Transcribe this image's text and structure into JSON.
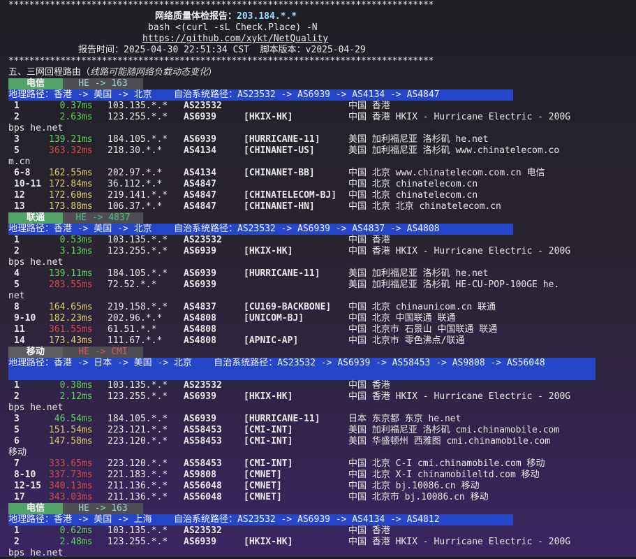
{
  "stars": "**********************************************************************************",
  "header": {
    "title": "网络质量体检报告：",
    "ip": "203.184.*.*",
    "command": "bash <(curl -sL Check.Place) -N",
    "url": "https://github.com/xykt/NetQuality",
    "report_time": "报告时间：2025-04-30 22:51:34 CST  脚本版本：v2025-04-29"
  },
  "section": {
    "title": "五、三网回程路由（",
    "note": "线路可能随网络负载动态变化",
    "close": "）"
  },
  "colors": {
    "path_bar": "#2546c8",
    "isp_tag": "#53a26a",
    "latency_good": "#5fd35f",
    "latency_bad": "#d84848"
  },
  "routes": [
    {
      "isp": "电信",
      "tag_path": "HE -> 163",
      "geo_path": "地理路径：香港 -> 美国 -> 北京",
      "as_path": "自治系统路径：AS23532 -> AS6939 -> AS4134 -> AS4847",
      "hops": [
        {
          "hop": "1",
          "latency": "0.37ms",
          "lat_class": "g",
          "ip": "103.135.*.*",
          "asn": "AS23532",
          "name": "",
          "geo": "中国 香港",
          "wrap": ""
        },
        {
          "hop": "2",
          "latency": "2.63ms",
          "lat_class": "g",
          "ip": "123.255.*.*",
          "asn": "AS6939",
          "name": "[HKIX-HK]",
          "geo": "中国 香港 HKIX - Hurricane Electric - 200G",
          "wrap": "bps he.net"
        },
        {
          "hop": "3",
          "latency": "139.21ms",
          "lat_class": "g",
          "ip": "184.105.*.*",
          "asn": "AS6939",
          "name": "[HURRICANE-11]",
          "geo": "美国 加利福尼亚 洛杉矶 he.net",
          "wrap": ""
        },
        {
          "hop": "5",
          "latency": "363.32ms",
          "lat_class": "r",
          "ip": "218.30.*.*",
          "asn": "AS4134",
          "name": "[CHINANET-US]",
          "geo": "美国 加利福尼亚 洛杉矶 www.chinatelecom.co",
          "wrap": "m.cn"
        },
        {
          "hop": "6-8",
          "latency": "162.55ms",
          "lat_class": "o",
          "ip": "202.97.*.*",
          "asn": "AS4134",
          "name": "[CHINANET-BB]",
          "geo": "中国 北京 www.chinatelecom.com.cn 电信",
          "wrap": ""
        },
        {
          "hop": "10-11",
          "latency": "172.84ms",
          "lat_class": "o",
          "ip": "36.112.*.*",
          "asn": "AS4847",
          "name": "",
          "geo": "中国 北京 chinatelecom.cn",
          "wrap": ""
        },
        {
          "hop": "12",
          "latency": "172.60ms",
          "lat_class": "o",
          "ip": "219.141.*.*",
          "asn": "AS4847",
          "name": "[CHINATELECOM-BJ]",
          "geo": "中国 北京 chinatelecom.cn",
          "wrap": ""
        },
        {
          "hop": "13",
          "latency": "173.88ms",
          "lat_class": "o",
          "ip": "106.37.*.*",
          "asn": "AS4847",
          "name": "[CHINANET-HN]",
          "geo": "中国 北京 北京 chinatelecom.cn",
          "wrap": ""
        }
      ]
    },
    {
      "isp": "联通",
      "tag_path": "HE -> 4837",
      "geo_path": "地理路径：香港 -> 美国 -> 北京",
      "as_path": "自治系统路径：AS23532 -> AS6939 -> AS4837 -> AS4808",
      "hops": [
        {
          "hop": "1",
          "latency": "0.53ms",
          "lat_class": "g",
          "ip": "103.135.*.*",
          "asn": "AS23532",
          "name": "",
          "geo": "中国 香港",
          "wrap": ""
        },
        {
          "hop": "2",
          "latency": "3.13ms",
          "lat_class": "g",
          "ip": "123.255.*.*",
          "asn": "AS6939",
          "name": "[HKIX-HK]",
          "geo": "中国 香港 HKIX - Hurricane Electric - 200G",
          "wrap": "bps he.net"
        },
        {
          "hop": "4",
          "latency": "139.11ms",
          "lat_class": "g",
          "ip": "184.105.*.*",
          "asn": "AS6939",
          "name": "[HURRICANE-11]",
          "geo": "美国 加利福尼亚 洛杉矶 he.net",
          "wrap": ""
        },
        {
          "hop": "5",
          "latency": "283.55ms",
          "lat_class": "r",
          "ip": "72.52.*.*",
          "asn": "AS6939",
          "name": "",
          "geo": "美国 加利福尼亚 洛杉矶 HE-CU-POP-100GE he.",
          "wrap": "net"
        },
        {
          "hop": "8",
          "latency": "164.65ms",
          "lat_class": "o",
          "ip": "219.158.*.*",
          "asn": "AS4837",
          "name": "[CU169-BACKBONE]",
          "geo": "中国 北京 chinaunicom.cn 联通",
          "wrap": ""
        },
        {
          "hop": "9-10",
          "latency": "182.23ms",
          "lat_class": "o",
          "ip": "202.96.*.*",
          "asn": "AS4808",
          "name": "[UNICOM-BJ]",
          "geo": "中国 北京 中国联通 联通",
          "wrap": ""
        },
        {
          "hop": "11",
          "latency": "361.55ms",
          "lat_class": "r",
          "ip": "61.51.*.*",
          "asn": "AS4808",
          "name": "",
          "geo": "中国 北京市 石景山 中国联通 联通",
          "wrap": ""
        },
        {
          "hop": "14",
          "latency": "173.43ms",
          "lat_class": "o",
          "ip": "111.67.*.*",
          "asn": "AS4808",
          "name": "[APNIC-AP]",
          "geo": "中国 北京市 零色沸点/联通",
          "wrap": ""
        }
      ]
    },
    {
      "isp": "移动",
      "tag_path": "HE -> CMI",
      "geo_path": "地理路径：香港 -> 日本 -> 美国 -> 北京",
      "as_path": "自治系统路径：AS23532 -> AS6939 -> AS58453 -> AS9808 -> AS56048",
      "hops": [
        {
          "hop": "1",
          "latency": "0.38ms",
          "lat_class": "g",
          "ip": "103.135.*.*",
          "asn": "AS23532",
          "name": "",
          "geo": "中国 香港",
          "wrap": ""
        },
        {
          "hop": "2",
          "latency": "2.12ms",
          "lat_class": "g",
          "ip": "123.255.*.*",
          "asn": "AS6939",
          "name": "[HKIX-HK]",
          "geo": "中国 香港 HKIX - Hurricane Electric - 200G",
          "wrap": "bps he.net"
        },
        {
          "hop": "3",
          "latency": "46.54ms",
          "lat_class": "g",
          "ip": "184.105.*.*",
          "asn": "AS6939",
          "name": "[HURRICANE-11]",
          "geo": "日本 东京都 东京 he.net",
          "wrap": ""
        },
        {
          "hop": "5",
          "latency": "151.54ms",
          "lat_class": "o",
          "ip": "223.121.*.*",
          "asn": "AS58453",
          "name": "[CMI-INT]",
          "geo": "美国 加利福尼亚 洛杉矶 cmi.chinamobile.com",
          "wrap": ""
        },
        {
          "hop": "6",
          "latency": "147.58ms",
          "lat_class": "o",
          "ip": "223.120.*.*",
          "asn": "AS58453",
          "name": "[CMI-INT]",
          "geo": "美国 华盛顿州 西雅图 cmi.chinamobile.com",
          "wrap": "移动"
        },
        {
          "hop": "7",
          "latency": "333.65ms",
          "lat_class": "r",
          "ip": "223.120.*.*",
          "asn": "AS58453",
          "name": "[CMI-INT]",
          "geo": "中国 北京 C-I cmi.chinamobile.com 移动",
          "wrap": ""
        },
        {
          "hop": "8-10",
          "latency": "337.73ms",
          "lat_class": "r",
          "ip": "221.183.*.*",
          "asn": "AS9808",
          "name": "[CMNET]",
          "geo": "中国 北京 X-I chinamobileltd.com 移动",
          "wrap": ""
        },
        {
          "hop": "12-15",
          "latency": "340.13ms",
          "lat_class": "r",
          "ip": "211.136.*.*",
          "asn": "AS56048",
          "name": "[CMNET]",
          "geo": "中国 北京 bj.10086.cn 移动",
          "wrap": ""
        },
        {
          "hop": "17",
          "latency": "343.03ms",
          "lat_class": "r",
          "ip": "211.136.*.*",
          "asn": "AS56048",
          "name": "[CMNET]",
          "geo": "中国 北京市 bj.10086.cn 移动",
          "wrap": ""
        }
      ]
    },
    {
      "isp": "电信",
      "tag_path": "HE -> 163",
      "geo_path": "地理路径：香港 -> 美国 -> 上海",
      "as_path": "自治系统路径：AS23532 -> AS6939 -> AS4134 -> AS4812",
      "hops": [
        {
          "hop": "1",
          "latency": "0.62ms",
          "lat_class": "g",
          "ip": "103.135.*.*",
          "asn": "AS23532",
          "name": "",
          "geo": "中国 香港",
          "wrap": ""
        },
        {
          "hop": "2",
          "latency": "2.48ms",
          "lat_class": "g",
          "ip": "123.255.*.*",
          "asn": "AS6939",
          "name": "[HKIX-HK]",
          "geo": "中国 香港 HKIX - Hurricane Electric - 200G",
          "wrap": "bps he.net"
        }
      ]
    }
  ]
}
